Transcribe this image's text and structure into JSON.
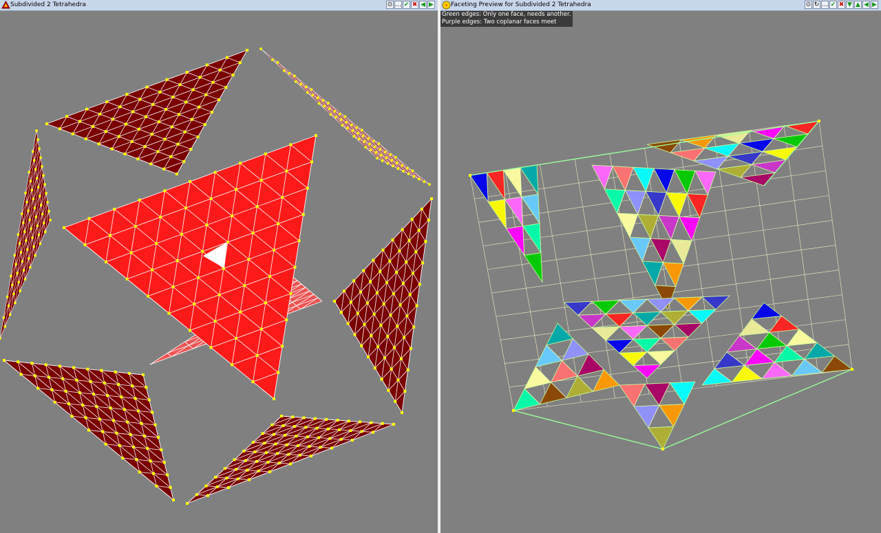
{
  "left_window": {
    "title": "Subdivided 2 Tetrahedra",
    "app_icon": "polyhedron-icon",
    "toolbar": [
      {
        "name": "target-icon",
        "glyph": "⊙"
      },
      {
        "name": "more-icon",
        "glyph": "…"
      },
      {
        "name": "check-icon",
        "glyph": "✔"
      },
      {
        "name": "close-icon",
        "glyph": "✖"
      },
      {
        "name": "prev-icon",
        "glyph": "◀"
      },
      {
        "name": "next-icon",
        "glyph": "▶"
      }
    ]
  },
  "right_window": {
    "title": "Faceting Preview for Subdivided 2 Tetrahedra",
    "app_icon": "faceting-icon",
    "legend": {
      "line1": "Green edges: Only one face, needs another.",
      "line2": "Purple edges: Two coplanar faces meet"
    },
    "toolbar": [
      {
        "name": "target-icon",
        "glyph": "⊙"
      },
      {
        "name": "reset-icon",
        "glyph": "↻"
      },
      {
        "name": "more-icon",
        "glyph": "…"
      },
      {
        "name": "check-icon",
        "glyph": "✔"
      },
      {
        "name": "close-icon",
        "glyph": "✖"
      },
      {
        "name": "down-icon",
        "glyph": "▼"
      },
      {
        "name": "up-icon",
        "glyph": "▲"
      },
      {
        "name": "prev-icon",
        "glyph": "◀"
      },
      {
        "name": "next-icon",
        "glyph": "▶"
      }
    ]
  },
  "colors": {
    "background": "#808080",
    "vertex": "#ffff00",
    "dark_face": "#7a0000",
    "bright_face": "#ff1a1a",
    "edge": "#ffffff",
    "titlebar": "#c8d6ea",
    "legend_bg": "#3a3a3a"
  }
}
